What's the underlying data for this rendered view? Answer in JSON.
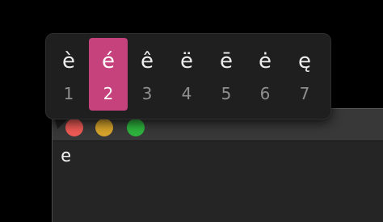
{
  "colors": {
    "background": "#000000",
    "popover_bg": "#1f1f1f",
    "selection": "#c5427c",
    "titlebar": "#383838",
    "editor_bg": "#252525",
    "close": "#ed5a55",
    "minimize": "#d6a42c",
    "zoom": "#2eb33d"
  },
  "window": {
    "buttons": [
      "close-button",
      "minimize-button",
      "zoom-button"
    ]
  },
  "editor": {
    "text": "e"
  },
  "accent_menu": {
    "selected_index": 2,
    "options": [
      {
        "char": "è",
        "number": "1"
      },
      {
        "char": "é",
        "number": "2"
      },
      {
        "char": "ê",
        "number": "3"
      },
      {
        "char": "ë",
        "number": "4"
      },
      {
        "char": "ē",
        "number": "5"
      },
      {
        "char": "ė",
        "number": "6"
      },
      {
        "char": "ę",
        "number": "7"
      }
    ]
  }
}
